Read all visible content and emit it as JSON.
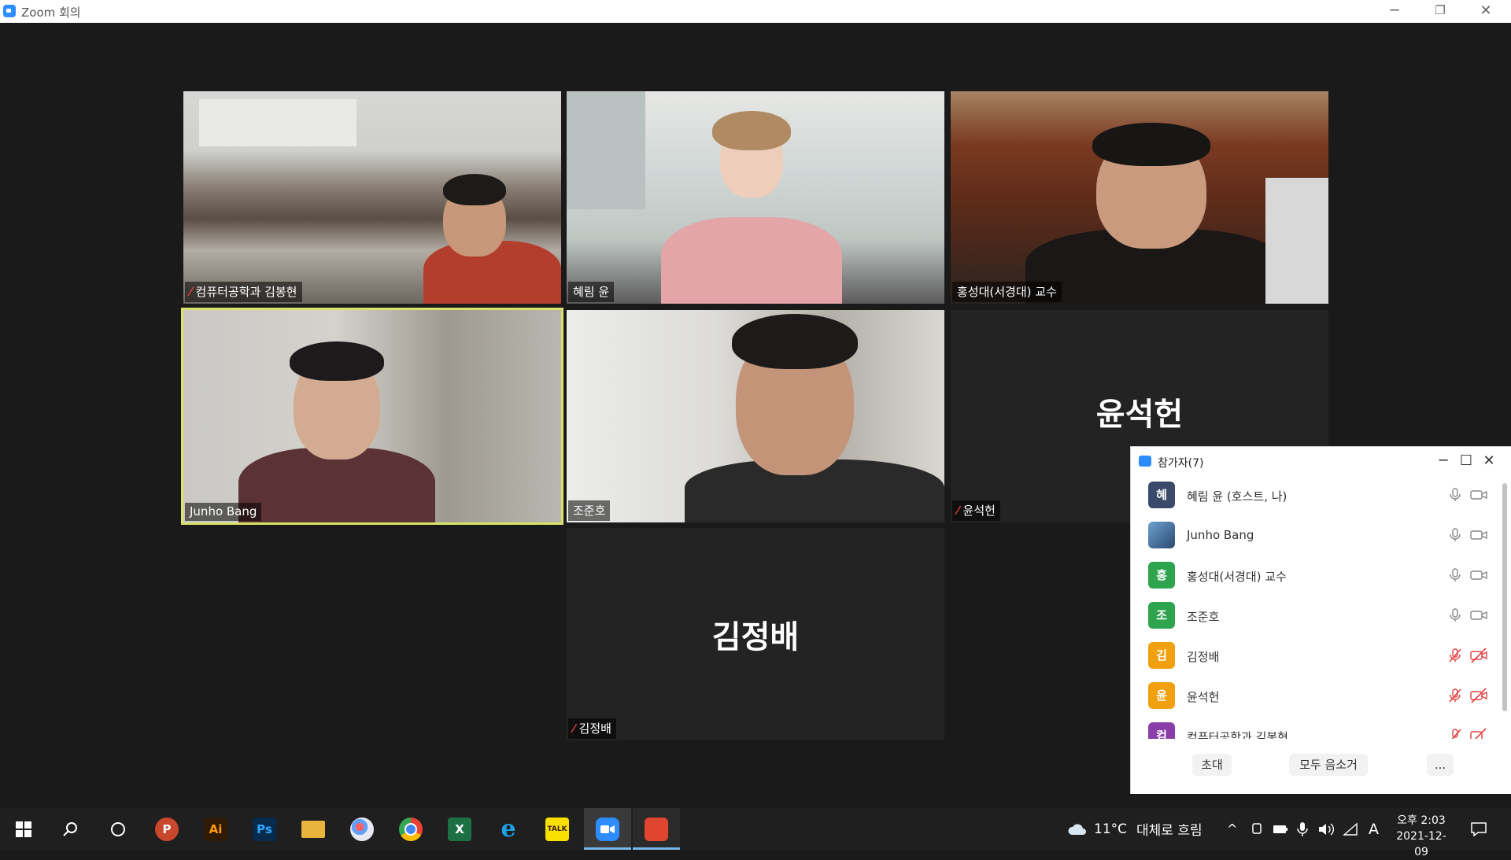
{
  "window": {
    "title": "Zoom 회의",
    "controls": {
      "minimize": "─",
      "maximize": "❐",
      "close": "✕"
    }
  },
  "tiles": [
    {
      "name": "컴퓨터공학과 김봉현",
      "muted": true,
      "video": true
    },
    {
      "name": "혜림 윤",
      "muted": false,
      "video": true
    },
    {
      "name": "홍성대(서경대) 교수",
      "muted": false,
      "video": true
    },
    {
      "name": "Junho Bang",
      "muted": false,
      "video": true,
      "speaking": true
    },
    {
      "name": "조준호",
      "muted": false,
      "video": true
    },
    {
      "name": "윤석헌",
      "muted": true,
      "video": false,
      "big_label": "윤석헌"
    },
    {
      "name": "김정배",
      "muted": true,
      "video": false,
      "big_label": "김정배"
    }
  ],
  "participants_panel": {
    "title": "참가자(7)",
    "controls": {
      "minimize": "─",
      "maximize": "☐",
      "close": "✕"
    },
    "participants": [
      {
        "avatar": "혜",
        "avatar_color": "#3b4a6b",
        "name": "혜림 윤 (호스트, 나)",
        "mic_off": false,
        "video_off": false
      },
      {
        "avatar": "",
        "avatar_color": "#4a78a8",
        "name": "Junho Bang",
        "mic_off": false,
        "video_off": false
      },
      {
        "avatar": "홍",
        "avatar_color": "#2ea44f",
        "name": "홍성대(서경대) 교수",
        "mic_off": false,
        "video_off": false
      },
      {
        "avatar": "조",
        "avatar_color": "#2ea44f",
        "name": "조준호",
        "mic_off": false,
        "video_off": false
      },
      {
        "avatar": "김",
        "avatar_color": "#f0a010",
        "name": "김정배",
        "mic_off": true,
        "video_off": true
      },
      {
        "avatar": "윤",
        "avatar_color": "#f0a010",
        "name": "윤석헌",
        "mic_off": true,
        "video_off": true
      },
      {
        "avatar": "컴",
        "avatar_color": "#8a3fa8",
        "name": "컴퓨터공학과 김봉현",
        "mic_off": true,
        "video_off": true
      }
    ],
    "footer": {
      "invite": "초대",
      "mute_all": "모두 음소거",
      "more": "..."
    }
  },
  "taskbar": {
    "apps": [
      {
        "label": "",
        "color": "#1f1f1f",
        "name": "start"
      },
      {
        "label": "",
        "color": "#1f1f1f",
        "name": "search"
      },
      {
        "label": "",
        "color": "#1f1f1f",
        "name": "task-view"
      },
      {
        "label": "P",
        "color": "#c9472b",
        "name": "powerpoint"
      },
      {
        "label": "Ai",
        "color": "#2f1b05",
        "name": "illustrator"
      },
      {
        "label": "Ps",
        "color": "#072a4d",
        "name": "photoshop"
      },
      {
        "label": "",
        "color": "#e8b43c",
        "name": "file-explorer"
      },
      {
        "label": "",
        "color": "#d8d8e8",
        "name": "paint"
      },
      {
        "label": "",
        "color": "#1f1f1f",
        "name": "chrome"
      },
      {
        "label": "X",
        "color": "#1d7044",
        "name": "excel"
      },
      {
        "label": "e",
        "color": "#1f1f1f",
        "name": "internet-explorer"
      },
      {
        "label": "TALK",
        "color": "#f9e000",
        "name": "kakaotalk"
      },
      {
        "label": "",
        "color": "#2d8cff",
        "name": "zoom"
      },
      {
        "label": "",
        "color": "#e0452f",
        "name": "app-red"
      }
    ],
    "weather": {
      "temp": "11°C",
      "desc": "대체로 흐림"
    },
    "ime": "A",
    "clock": {
      "time": "오후 2:03",
      "date": "2021-12-09"
    }
  }
}
